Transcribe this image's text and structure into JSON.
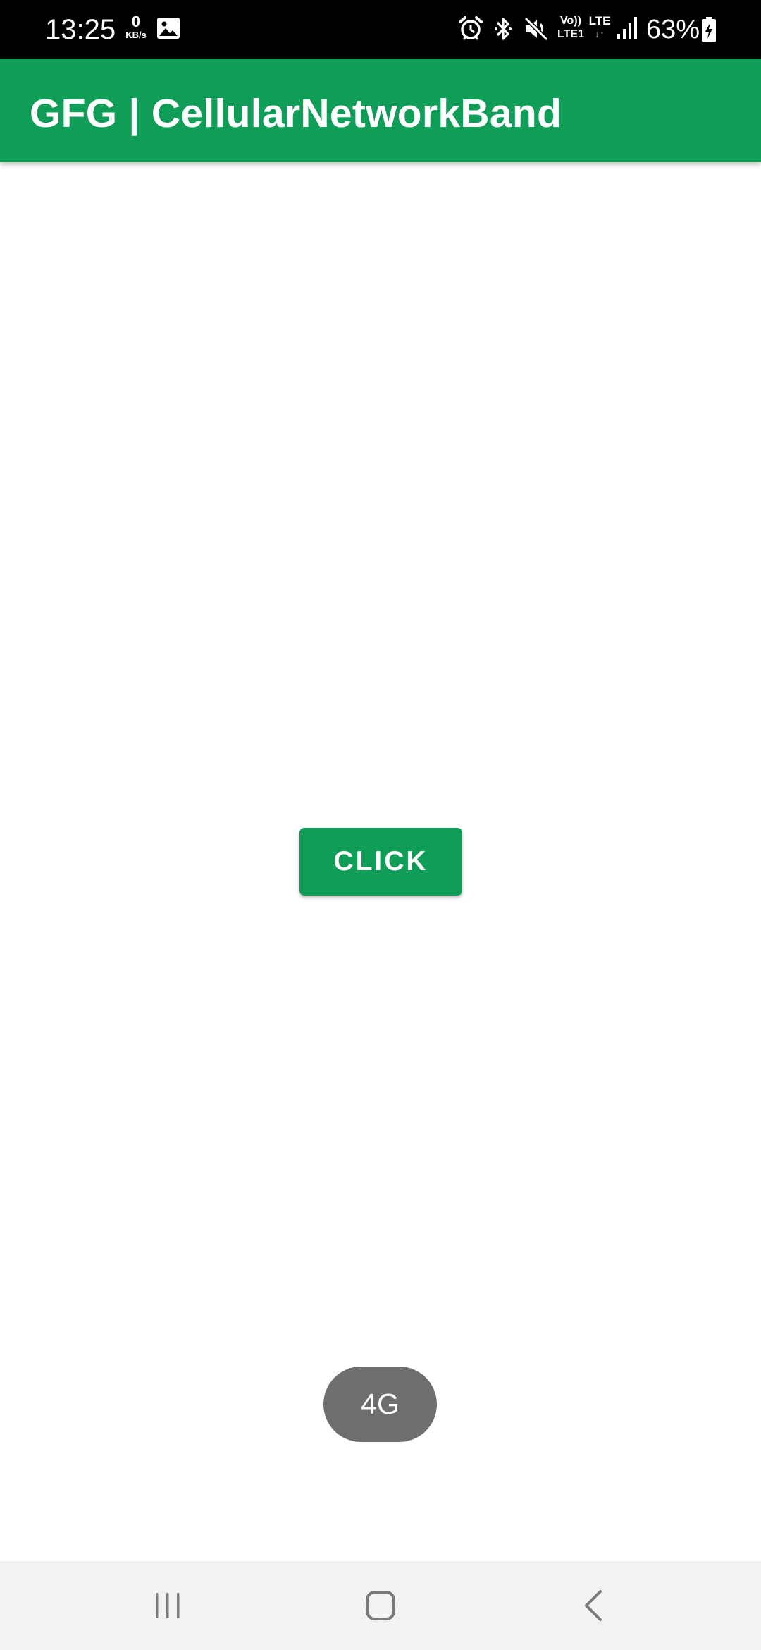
{
  "status_bar": {
    "time": "13:25",
    "net_speed_value": "0",
    "net_speed_unit": "KB/s",
    "volte_line1": "Vo))",
    "volte_line2": "LTE1",
    "lte_label": "LTE",
    "lte_arrows": "↓↑",
    "battery_percent": "63%",
    "icons": [
      "gallery-icon",
      "alarm-icon",
      "bluetooth-icon",
      "mute-icon",
      "volte-icon",
      "lte-icon",
      "signal-icon",
      "battery-charging-icon"
    ]
  },
  "app_bar": {
    "title": "GFG | CellularNetworkBand",
    "color": "#0f9d58"
  },
  "main": {
    "button_label": "CLICK",
    "button_color": "#0f9d58"
  },
  "toast": {
    "text": "4G",
    "background": "#6e6e6e"
  },
  "nav_bar": {
    "icons": [
      "recents-icon",
      "home-icon",
      "back-icon"
    ]
  }
}
